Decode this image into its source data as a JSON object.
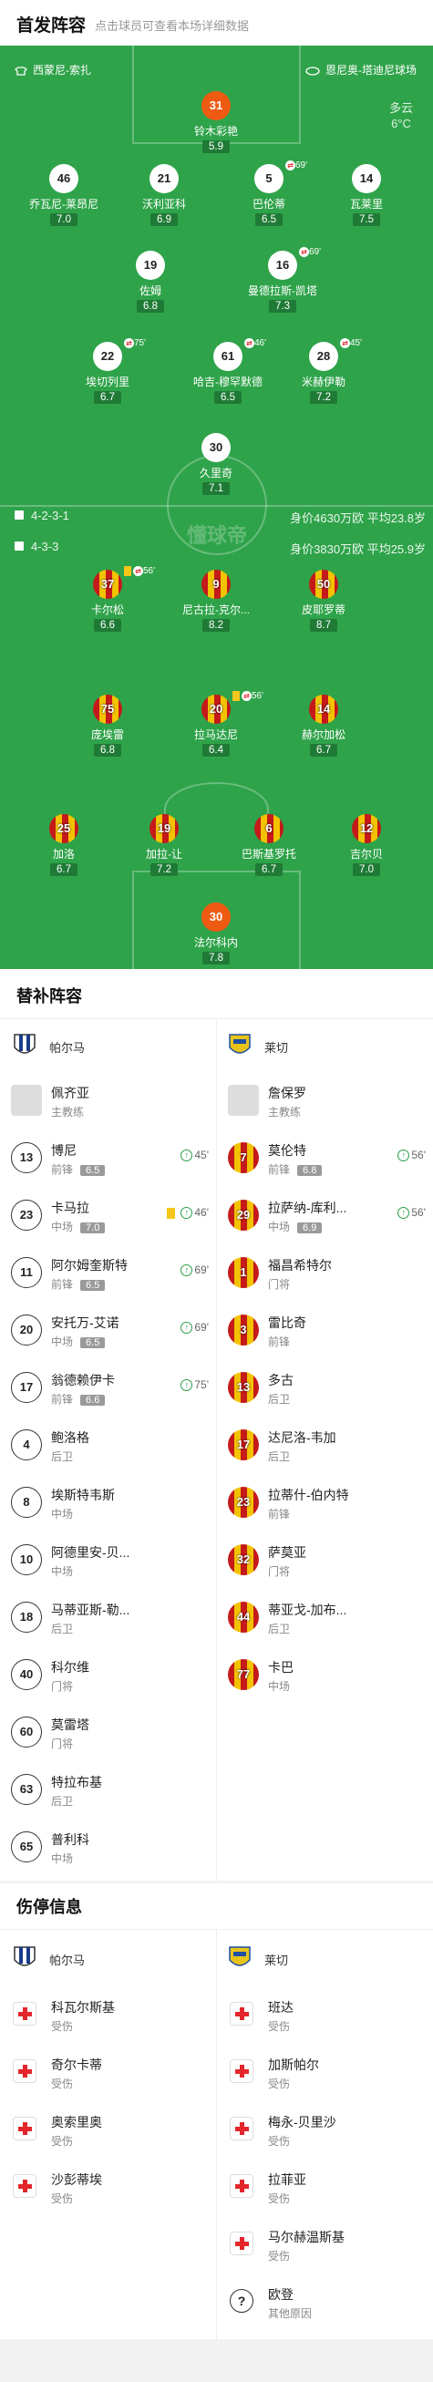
{
  "header": {
    "title": "首发阵容",
    "subtitle": "点击球员可查看本场详细数据"
  },
  "pitch": {
    "home_team": "西蒙尼-索扎",
    "away_team": "恩尼奥-塔迪尼球场",
    "weather": {
      "desc": "多云",
      "temp": "6°C"
    },
    "watermark": "懂球帝",
    "top_form": "4-2-3-1",
    "top_worth": "身价4630万欧 平均23.8岁",
    "bottom_form": "4-3-3",
    "bottom_worth": "身价3830万欧 平均25.9岁",
    "top_players": [
      {
        "num": "31",
        "name": "铃木彩艳",
        "rating": "5.9",
        "style": "o"
      },
      {
        "num": "46",
        "name": "乔瓦尼-莱昂尼",
        "rating": "7.0",
        "style": "w"
      },
      {
        "num": "21",
        "name": "沃利亚科",
        "rating": "6.9",
        "style": "w"
      },
      {
        "num": "5",
        "name": "巴伦蒂",
        "rating": "6.5",
        "style": "w",
        "ev": "69'"
      },
      {
        "num": "14",
        "name": "瓦莱里",
        "rating": "7.5",
        "style": "w"
      },
      {
        "num": "19",
        "name": "佐姆",
        "rating": "6.8",
        "style": "w"
      },
      {
        "num": "16",
        "name": "曼德拉斯-凯塔",
        "rating": "7.3",
        "style": "w",
        "ev": "69'"
      },
      {
        "num": "22",
        "name": "埃切列里",
        "rating": "6.7",
        "style": "w",
        "ev": "75'"
      },
      {
        "num": "61",
        "name": "哈吉-穆罕默德",
        "rating": "6.5",
        "style": "w",
        "ev": "46'"
      },
      {
        "num": "28",
        "name": "米赫伊勒",
        "rating": "7.2",
        "style": "w",
        "ev": "45'"
      },
      {
        "num": "30",
        "name": "久里奇",
        "rating": "7.1",
        "style": "w"
      }
    ],
    "bottom_players": [
      {
        "num": "37",
        "name": "卡尔松",
        "rating": "6.6",
        "ev": "56'"
      },
      {
        "num": "9",
        "name": "尼古拉-克尔...",
        "rating": "8.2"
      },
      {
        "num": "50",
        "name": "皮耶罗蒂",
        "rating": "8.7"
      },
      {
        "num": "75",
        "name": "庞埃雷",
        "rating": "6.8"
      },
      {
        "num": "20",
        "name": "拉马达尼",
        "rating": "6.4",
        "ev": "56'"
      },
      {
        "num": "14",
        "name": "赫尔加松",
        "rating": "6.7"
      },
      {
        "num": "25",
        "name": "加洛",
        "rating": "6.7"
      },
      {
        "num": "19",
        "name": "加拉-让",
        "rating": "7.2"
      },
      {
        "num": "6",
        "name": "巴斯基罗托",
        "rating": "6.7"
      },
      {
        "num": "12",
        "name": "吉尔贝",
        "rating": "7.0"
      },
      {
        "num": "30",
        "name": "法尔科内",
        "rating": "7.8",
        "style": "o"
      }
    ]
  },
  "subs": {
    "title": "替补阵容",
    "left_team": "帕尔马",
    "right_team": "莱切",
    "left": [
      {
        "num": "",
        "name": "佩齐亚",
        "pos": "主教练",
        "coach": true
      },
      {
        "num": "13",
        "name": "博尼",
        "pos": "前锋",
        "rating": "6.5",
        "min": "45'"
      },
      {
        "num": "23",
        "name": "卡马拉",
        "pos": "中场",
        "rating": "7.0",
        "min": "46'",
        "yc": true
      },
      {
        "num": "11",
        "name": "阿尔姆奎斯特",
        "pos": "前锋",
        "rating": "6.5",
        "min": "69'"
      },
      {
        "num": "20",
        "name": "安托万-艾诺",
        "pos": "中场",
        "rating": "6.5",
        "min": "69'"
      },
      {
        "num": "17",
        "name": "翁德赖伊卡",
        "pos": "前锋",
        "rating": "6.6",
        "min": "75'"
      },
      {
        "num": "4",
        "name": "鲍洛格",
        "pos": "后卫"
      },
      {
        "num": "8",
        "name": "埃斯特韦斯",
        "pos": "中场"
      },
      {
        "num": "10",
        "name": "阿德里安-贝...",
        "pos": "中场"
      },
      {
        "num": "18",
        "name": "马蒂亚斯-勒...",
        "pos": "后卫"
      },
      {
        "num": "40",
        "name": "科尔维",
        "pos": "门将"
      },
      {
        "num": "60",
        "name": "莫雷塔",
        "pos": "门将"
      },
      {
        "num": "63",
        "name": "特拉布基",
        "pos": "后卫"
      },
      {
        "num": "65",
        "name": "普利科",
        "pos": "中场"
      }
    ],
    "right": [
      {
        "num": "",
        "name": "詹保罗",
        "pos": "主教练",
        "coach": true
      },
      {
        "num": "7",
        "name": "莫伦特",
        "pos": "前锋",
        "rating": "6.8",
        "min": "56'"
      },
      {
        "num": "29",
        "name": "拉萨纳-库利...",
        "pos": "中场",
        "rating": "6.9",
        "min": "56'"
      },
      {
        "num": "1",
        "name": "福昌希特尔",
        "pos": "门将"
      },
      {
        "num": "3",
        "name": "雷比奇",
        "pos": "前锋"
      },
      {
        "num": "13",
        "name": "多古",
        "pos": "后卫"
      },
      {
        "num": "17",
        "name": "达尼洛-韦加",
        "pos": "后卫"
      },
      {
        "num": "23",
        "name": "拉蒂什-伯内特",
        "pos": "前锋"
      },
      {
        "num": "32",
        "name": "萨莫亚",
        "pos": "门将"
      },
      {
        "num": "44",
        "name": "蒂亚戈-加布...",
        "pos": "后卫"
      },
      {
        "num": "77",
        "name": "卡巴",
        "pos": "中场"
      }
    ]
  },
  "injuries": {
    "title": "伤停信息",
    "left_team": "帕尔马",
    "right_team": "莱切",
    "left": [
      {
        "name": "科瓦尔斯基",
        "reason": "受伤"
      },
      {
        "name": "奇尔卡蒂",
        "reason": "受伤"
      },
      {
        "name": "奥索里奥",
        "reason": "受伤"
      },
      {
        "name": "沙彭蒂埃",
        "reason": "受伤"
      }
    ],
    "right": [
      {
        "name": "班达",
        "reason": "受伤"
      },
      {
        "name": "加斯帕尔",
        "reason": "受伤"
      },
      {
        "name": "梅永-贝里沙",
        "reason": "受伤"
      },
      {
        "name": "拉菲亚",
        "reason": "受伤"
      },
      {
        "name": "马尔赫温斯基",
        "reason": "受伤"
      },
      {
        "name": "欧登",
        "reason": "其他原因",
        "q": true
      }
    ]
  }
}
